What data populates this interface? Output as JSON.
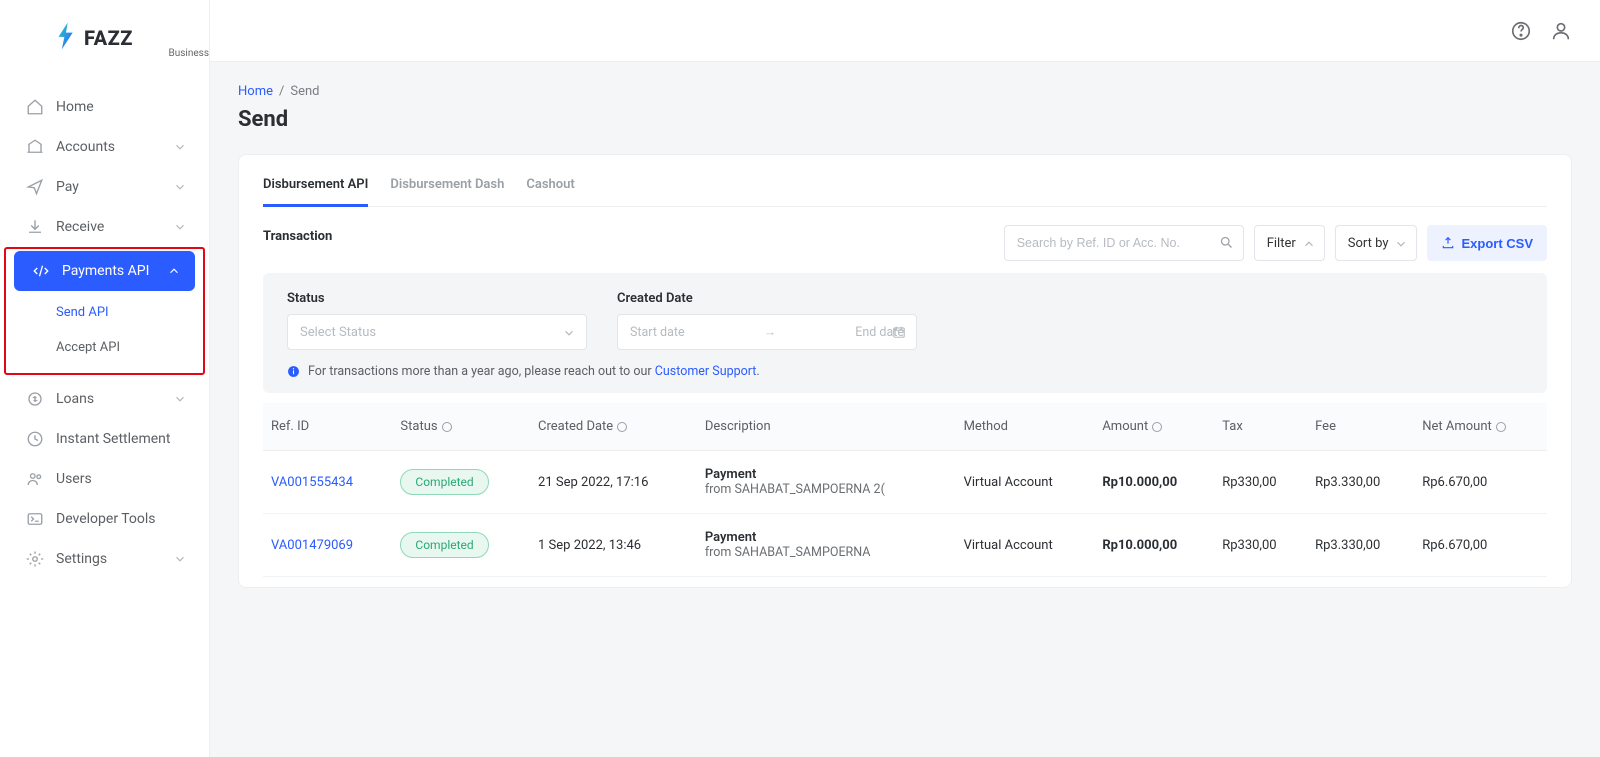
{
  "brand": {
    "name": "FAZZ",
    "sub": "Business"
  },
  "sidebar": {
    "items": [
      {
        "label": "Home"
      },
      {
        "label": "Accounts"
      },
      {
        "label": "Pay"
      },
      {
        "label": "Receive"
      },
      {
        "label": "Payments API"
      },
      {
        "label": "Loans"
      },
      {
        "label": "Instant Settlement"
      },
      {
        "label": "Users"
      },
      {
        "label": "Developer Tools"
      },
      {
        "label": "Settings"
      }
    ],
    "payments_sub": [
      {
        "label": "Send API"
      },
      {
        "label": "Accept API"
      }
    ]
  },
  "breadcrumb": {
    "home": "Home",
    "sep": "/",
    "current": "Send"
  },
  "page_title": "Send",
  "tabs": [
    {
      "label": "Disbursement API"
    },
    {
      "label": "Disbursement Dash"
    },
    {
      "label": "Cashout"
    }
  ],
  "section_label": "Transaction",
  "search_placeholder": "Search by Ref. ID or Acc. No.",
  "filter_label": "Filter",
  "sort_label": "Sort by",
  "export_label": "Export CSV",
  "filter_panel": {
    "status_label": "Status",
    "status_placeholder": "Select Status",
    "date_label": "Created Date",
    "start_placeholder": "Start date",
    "end_placeholder": "End date",
    "info_prefix": "For transactions more than a year ago, please reach out to our ",
    "info_link": "Customer Support",
    "info_suffix": "."
  },
  "table": {
    "headers": {
      "ref": "Ref. ID",
      "status": "Status",
      "created": "Created Date",
      "desc": "Description",
      "method": "Method",
      "amount": "Amount",
      "tax": "Tax",
      "fee": "Fee",
      "net": "Net Amount"
    },
    "rows": [
      {
        "ref": "VA001555434",
        "status": "Completed",
        "created": "21 Sep 2022, 17:16",
        "desc_title": "Payment",
        "desc_sub": "from SAHABAT_SAMPOERNA 2(",
        "method": "Virtual Account",
        "amount": "Rp10.000,00",
        "tax": "Rp330,00",
        "fee": "Rp3.330,00",
        "net": "Rp6.670,00"
      },
      {
        "ref": "VA001479069",
        "status": "Completed",
        "created": "1 Sep 2022, 13:46",
        "desc_title": "Payment",
        "desc_sub": "from SAHABAT_SAMPOERNA",
        "method": "Virtual Account",
        "amount": "Rp10.000,00",
        "tax": "Rp330,00",
        "fee": "Rp3.330,00",
        "net": "Rp6.670,00"
      }
    ]
  }
}
